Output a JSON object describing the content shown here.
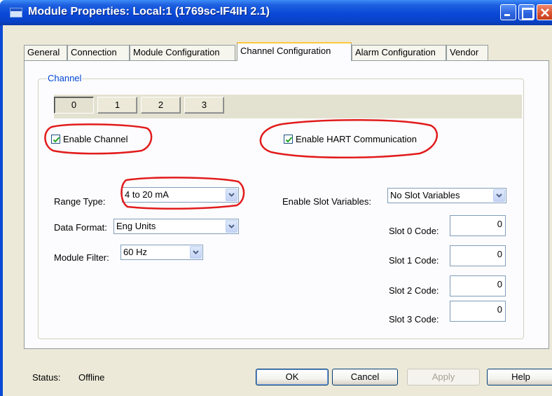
{
  "window": {
    "title": "Module Properties: Local:1 (1769sc-IF4IH 2.1)"
  },
  "tabs": [
    {
      "label": "General"
    },
    {
      "label": "Connection"
    },
    {
      "label": "Module Configuration"
    },
    {
      "label": "Channel Configuration",
      "active": true
    },
    {
      "label": "Alarm Configuration"
    },
    {
      "label": "Vendor"
    }
  ],
  "channel_group": {
    "title": "Channel",
    "channels": [
      "0",
      "1",
      "2",
      "3"
    ],
    "selected_channel": "0"
  },
  "enable_channel": {
    "label": "Enable Channel",
    "checked": true
  },
  "enable_hart": {
    "label": "Enable HART Communication",
    "checked": true
  },
  "range_type": {
    "label": "Range Type:",
    "value": "4 to 20 mA"
  },
  "data_format": {
    "label": "Data Format:",
    "value": "Eng Units"
  },
  "module_filter": {
    "label": "Module Filter:",
    "value": "60 Hz"
  },
  "slot_variables": {
    "label": "Enable Slot Variables:",
    "value": "No Slot Variables"
  },
  "slot_codes": [
    {
      "label": "Slot 0 Code:",
      "value": "0"
    },
    {
      "label": "Slot 1 Code:",
      "value": "0"
    },
    {
      "label": "Slot 2 Code:",
      "value": "0"
    },
    {
      "label": "Slot 3 Code:",
      "value": "0"
    }
  ],
  "status": {
    "label": "Status:",
    "value": "Offline"
  },
  "buttons": {
    "ok": "OK",
    "cancel": "Cancel",
    "apply": "Apply",
    "help": "Help"
  },
  "colors": {
    "title_bar": "#0a48d6",
    "annotation": "#e21b1b",
    "group_title": "#0046d5",
    "dialog_face": "#ece9d8"
  }
}
